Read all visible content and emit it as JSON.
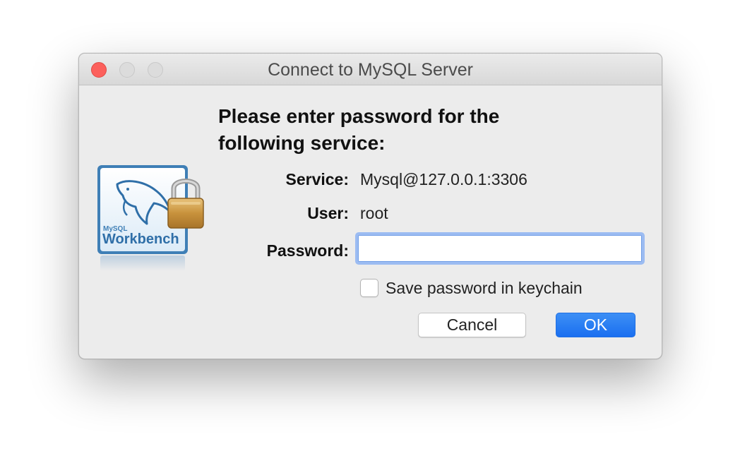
{
  "window": {
    "title": "Connect to MySQL Server"
  },
  "prompt": {
    "line1": "Please enter password for the",
    "line2": "following service:"
  },
  "logo": {
    "brand_small": "MySQL",
    "brand_large": "Workbench"
  },
  "fields": {
    "service_label": "Service:",
    "service_value": "Mysql@127.0.0.1:3306",
    "user_label": "User:",
    "user_value": "root",
    "password_label": "Password:",
    "password_value": ""
  },
  "keychain": {
    "label": "Save password in keychain",
    "checked": false
  },
  "buttons": {
    "cancel": "Cancel",
    "ok": "OK"
  },
  "colors": {
    "close": "#fc605c",
    "accent": "#1a6ff0",
    "focus_ring": "#9cbcf2"
  }
}
